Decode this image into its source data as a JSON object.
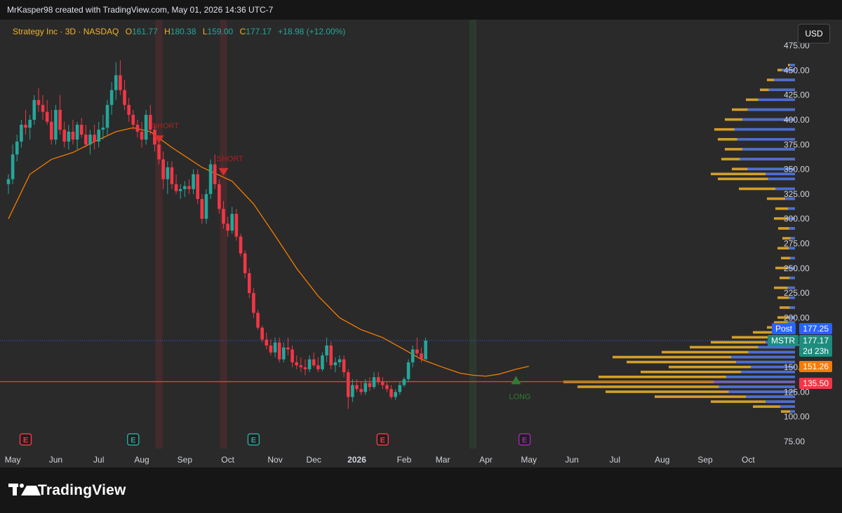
{
  "header": {
    "caption": "MrKasper98 created with TradingView.com, May 01, 2026 14:36 UTC-7"
  },
  "legend": {
    "symbol": "Strategy Inc · 3D · NASDAQ",
    "o_label": "O",
    "o": "161.77",
    "h_label": "H",
    "h": "180.38",
    "l_label": "L",
    "l": "159.00",
    "c_label": "C",
    "c": "177.17",
    "change": "+18.98 (+12.00%)"
  },
  "currency": "USD",
  "price_tags": {
    "post_label": "Post",
    "post_value": "177.25",
    "symbol": "MSTR",
    "last_value": "177.17",
    "countdown": "2d 23h",
    "ema_value": "151.26",
    "line_value": "135.50"
  },
  "footer": {
    "brand": "TradingView"
  },
  "colors": {
    "up": "#26a69a",
    "down": "#f23645",
    "ema": "#f57c00",
    "vp_up": "#f0b429",
    "vp_down": "#2962ff",
    "hline": "#f23645"
  },
  "chart_data": {
    "type": "candlestick",
    "title": "Strategy Inc · 3D · NASDAQ",
    "y_ticks": [
      75,
      100,
      125,
      150,
      175,
      200,
      225,
      250,
      275,
      300,
      325,
      350,
      375,
      400,
      425,
      450,
      475
    ],
    "y_tick_labels": [
      "75.00",
      "100.00",
      "125.00",
      "150.00",
      "175.00",
      "200.00",
      "225.00",
      "250.00",
      "275.00",
      "300.00",
      "325.00",
      "350.00",
      "375.00",
      "400.00",
      "425.00",
      "450.00",
      "475.00"
    ],
    "x_labels": [
      {
        "label": "May",
        "bar": 1
      },
      {
        "label": "Jun",
        "bar": 11
      },
      {
        "label": "Jul",
        "bar": 21
      },
      {
        "label": "Aug",
        "bar": 31
      },
      {
        "label": "Sep",
        "bar": 41
      },
      {
        "label": "Oct",
        "bar": 51
      },
      {
        "label": "Nov",
        "bar": 62
      },
      {
        "label": "Dec",
        "bar": 71
      },
      {
        "label": "2026",
        "bar": 81
      },
      {
        "label": "Feb",
        "bar": 92
      },
      {
        "label": "Mar",
        "bar": 101
      },
      {
        "label": "Apr",
        "bar": 111
      },
      {
        "label": "May",
        "bar": 121
      },
      {
        "label": "Jun",
        "bar": 131
      },
      {
        "label": "Jul",
        "bar": 141
      },
      {
        "label": "Aug",
        "bar": 152
      },
      {
        "label": "Sep",
        "bar": 162
      },
      {
        "label": "Oct",
        "bar": 172
      }
    ],
    "x_bold_labels": [
      "2026"
    ],
    "candles": [
      [
        335,
        345,
        325,
        340
      ],
      [
        340,
        375,
        335,
        365
      ],
      [
        365,
        385,
        358,
        378
      ],
      [
        378,
        400,
        372,
        395
      ],
      [
        395,
        410,
        385,
        392
      ],
      [
        392,
        405,
        380,
        400
      ],
      [
        400,
        425,
        395,
        420
      ],
      [
        420,
        432,
        408,
        415
      ],
      [
        415,
        425,
        400,
        408
      ],
      [
        408,
        420,
        395,
        398
      ],
      [
        398,
        410,
        375,
        380
      ],
      [
        380,
        415,
        375,
        410
      ],
      [
        410,
        425,
        385,
        390
      ],
      [
        390,
        398,
        372,
        378
      ],
      [
        378,
        395,
        370,
        388
      ],
      [
        388,
        400,
        375,
        380
      ],
      [
        380,
        398,
        370,
        395
      ],
      [
        395,
        402,
        382,
        385
      ],
      [
        385,
        395,
        372,
        375
      ],
      [
        375,
        390,
        365,
        385
      ],
      [
        385,
        395,
        370,
        378
      ],
      [
        378,
        398,
        372,
        390
      ],
      [
        390,
        405,
        380,
        392
      ],
      [
        392,
        420,
        385,
        415
      ],
      [
        415,
        438,
        405,
        430
      ],
      [
        430,
        458,
        420,
        445
      ],
      [
        445,
        460,
        425,
        430
      ],
      [
        430,
        440,
        410,
        415
      ],
      [
        415,
        422,
        398,
        405
      ],
      [
        405,
        410,
        390,
        395
      ],
      [
        395,
        400,
        382,
        388
      ],
      [
        388,
        398,
        372,
        380
      ],
      [
        380,
        410,
        375,
        405
      ],
      [
        405,
        415,
        385,
        390
      ],
      [
        390,
        395,
        368,
        375
      ],
      [
        375,
        382,
        355,
        360
      ],
      [
        360,
        368,
        330,
        340
      ],
      [
        340,
        358,
        325,
        352
      ],
      [
        352,
        358,
        330,
        335
      ],
      [
        335,
        345,
        325,
        328
      ],
      [
        328,
        335,
        320,
        330
      ],
      [
        330,
        338,
        322,
        333
      ],
      [
        333,
        340,
        325,
        330
      ],
      [
        330,
        350,
        325,
        345
      ],
      [
        345,
        350,
        315,
        320
      ],
      [
        320,
        325,
        295,
        300
      ],
      [
        300,
        330,
        295,
        325
      ],
      [
        325,
        360,
        320,
        355
      ],
      [
        355,
        365,
        330,
        335
      ],
      [
        335,
        340,
        305,
        310
      ],
      [
        310,
        318,
        290,
        295
      ],
      [
        295,
        302,
        282,
        288
      ],
      [
        288,
        312,
        285,
        305
      ],
      [
        305,
        310,
        278,
        282
      ],
      [
        282,
        285,
        262,
        265
      ],
      [
        265,
        268,
        240,
        245
      ],
      [
        245,
        250,
        220,
        225
      ],
      [
        225,
        230,
        200,
        205
      ],
      [
        205,
        208,
        188,
        190
      ],
      [
        190,
        192,
        175,
        178
      ],
      [
        178,
        185,
        168,
        172
      ],
      [
        172,
        178,
        162,
        165
      ],
      [
        165,
        180,
        160,
        175
      ],
      [
        175,
        180,
        155,
        158
      ],
      [
        158,
        175,
        155,
        170
      ],
      [
        170,
        180,
        162,
        168
      ],
      [
        168,
        172,
        150,
        155
      ],
      [
        155,
        162,
        148,
        152
      ],
      [
        152,
        160,
        145,
        150
      ],
      [
        150,
        158,
        142,
        148
      ],
      [
        148,
        162,
        145,
        158
      ],
      [
        158,
        165,
        150,
        152
      ],
      [
        152,
        160,
        145,
        148
      ],
      [
        148,
        165,
        146,
        162
      ],
      [
        162,
        180,
        155,
        172
      ],
      [
        172,
        176,
        148,
        152
      ],
      [
        152,
        160,
        145,
        155
      ],
      [
        155,
        162,
        150,
        158
      ],
      [
        158,
        162,
        140,
        145
      ],
      [
        145,
        148,
        108,
        120
      ],
      [
        120,
        138,
        115,
        132
      ],
      [
        132,
        138,
        125,
        128
      ],
      [
        128,
        135,
        122,
        125
      ],
      [
        125,
        138,
        122,
        134
      ],
      [
        134,
        140,
        126,
        130
      ],
      [
        130,
        145,
        128,
        140
      ],
      [
        140,
        145,
        132,
        135
      ],
      [
        135,
        140,
        128,
        132
      ],
      [
        132,
        136,
        125,
        128
      ],
      [
        128,
        132,
        118,
        120
      ],
      [
        120,
        128,
        117,
        125
      ],
      [
        125,
        135,
        122,
        132
      ],
      [
        132,
        140,
        130,
        138
      ],
      [
        138,
        158,
        135,
        155
      ],
      [
        155,
        172,
        150,
        168
      ],
      [
        168,
        180,
        160,
        164
      ],
      [
        164,
        170,
        155,
        158
      ],
      [
        158,
        180,
        159,
        177
      ]
    ],
    "ema": [
      [
        0,
        300
      ],
      [
        5,
        345
      ],
      [
        10,
        360
      ],
      [
        15,
        367
      ],
      [
        20,
        378
      ],
      [
        25,
        388
      ],
      [
        29,
        392
      ],
      [
        33,
        388
      ],
      [
        38,
        372
      ],
      [
        45,
        352
      ],
      [
        52,
        338
      ],
      [
        57,
        315
      ],
      [
        62,
        283
      ],
      [
        67,
        250
      ],
      [
        72,
        222
      ],
      [
        77,
        200
      ],
      [
        82,
        188
      ],
      [
        87,
        180
      ],
      [
        92,
        168
      ],
      [
        96,
        158
      ],
      [
        101,
        150
      ],
      [
        105,
        144
      ],
      [
        108,
        142
      ],
      [
        111,
        141
      ],
      [
        114,
        143
      ],
      [
        118,
        148
      ],
      [
        121,
        151
      ]
    ],
    "markers": [
      {
        "type": "short",
        "bar": 35,
        "price": 380,
        "label": "SHORT"
      },
      {
        "type": "short",
        "bar": 50,
        "price": 347,
        "label": "SHORT"
      },
      {
        "type": "long",
        "bar": 118,
        "price": 137,
        "label": "LONG"
      }
    ],
    "earnings": [
      {
        "bar": 4,
        "c": "red"
      },
      {
        "bar": 29,
        "c": "teal"
      },
      {
        "bar": 57,
        "c": "teal"
      },
      {
        "bar": 87,
        "c": "red"
      },
      {
        "bar": 120,
        "c": "purple"
      }
    ],
    "highlight_bands": [
      {
        "from": "Aug",
        "to": "Aug",
        "bar": 35,
        "c": "red"
      },
      {
        "bar": 50,
        "c": "red"
      },
      {
        "bar": 108,
        "c": "green"
      }
    ],
    "hline": 135.5,
    "volume_profile": {
      "split_price": 348,
      "levels": [
        105,
        110,
        115,
        120,
        125,
        130,
        135,
        140,
        145,
        150,
        155,
        160,
        165,
        170,
        175,
        180,
        185,
        190,
        195,
        200,
        210,
        220,
        230,
        240,
        250,
        260,
        270,
        280,
        290,
        300,
        310,
        320,
        330,
        340,
        345,
        350,
        360,
        370,
        380,
        390,
        400,
        410,
        420,
        430,
        440,
        450,
        455
      ],
      "widths": [
        20,
        60,
        120,
        200,
        270,
        310,
        330,
        280,
        220,
        180,
        240,
        260,
        190,
        150,
        120,
        90,
        60,
        40,
        30,
        25,
        22,
        25,
        30,
        22,
        28,
        20,
        25,
        18,
        24,
        30,
        28,
        40,
        80,
        110,
        120,
        90,
        105,
        100,
        110,
        115,
        100,
        90,
        70,
        50,
        40,
        25,
        10
      ]
    }
  }
}
